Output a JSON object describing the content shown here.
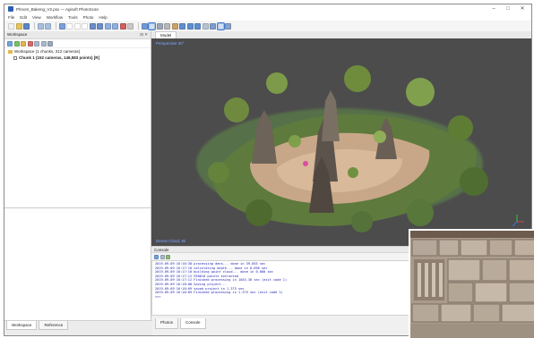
{
  "window": {
    "title": "Phnom_Bakeng_V2.psx — Agisoft PhotoScan",
    "controls": [
      "–",
      "□",
      "✕"
    ]
  },
  "menu": [
    "File",
    "Edit",
    "View",
    "Workflow",
    "Tools",
    "Photo",
    "Help"
  ],
  "workspace": {
    "title": "Workspace",
    "title_buttons": "⊟ ✕",
    "root_label": "Workspace (1 chunks, 312 cameras)",
    "chunk_label": "Chunk 1 (152 cameras, 146,583 points) [R]"
  },
  "model": {
    "tab_label": "Model",
    "view_label": "Perspective 30°",
    "bottom_label": "Dense Cloud, 5k"
  },
  "console": {
    "title": "Console",
    "lines": [
      "2019-09-09 16:16:38 processing dens... done in 39.055 sec",
      "2019-09-09 16:17:10 calculating depth... done in 0.656 sec",
      "2019-09-09 16:17:10 building point cloud... done in 0.000 sec",
      "2019-09-09 16:17:12 930010 points extracted",
      "2019-09-09 16:17:12 Finished processing in 1043.30 sec (exit code 1)",
      "2019-09-09 16:18:08 Saving project...",
      "2019-09-09 16:18:09 saved project in 1.375 sec",
      "2019-09-09 16:18:09 Finished processing in 1.375 sec (exit code 1)",
      ">>>"
    ]
  },
  "bottom_tabs": {
    "workspace": "Workspace",
    "reference": "Reference",
    "photos": "Photos",
    "console": "Console"
  },
  "icons": {
    "toolbar": [
      "new-icon",
      "open-icon",
      "save-icon",
      "undo-icon",
      "redo-icon",
      "select-icon",
      "rect-select-icon",
      "circle-select-icon",
      "free-select-icon",
      "move-icon",
      "rotate-icon",
      "zoom-in-icon",
      "zoom-out-icon",
      "delete-icon",
      "crop-icon",
      "points-icon",
      "dense-cloud-icon",
      "mesh-icon",
      "solid-icon",
      "textured-icon",
      "cameras-icon",
      "markers-icon",
      "regions-icon",
      "grid-icon",
      "reset-view-icon",
      "dense-cloud-active-icon",
      "options-icon"
    ]
  },
  "colors": {
    "viewport_bg": "#4c4c4c",
    "log_text": "#2222b0",
    "accent": "#3b7bd8"
  }
}
